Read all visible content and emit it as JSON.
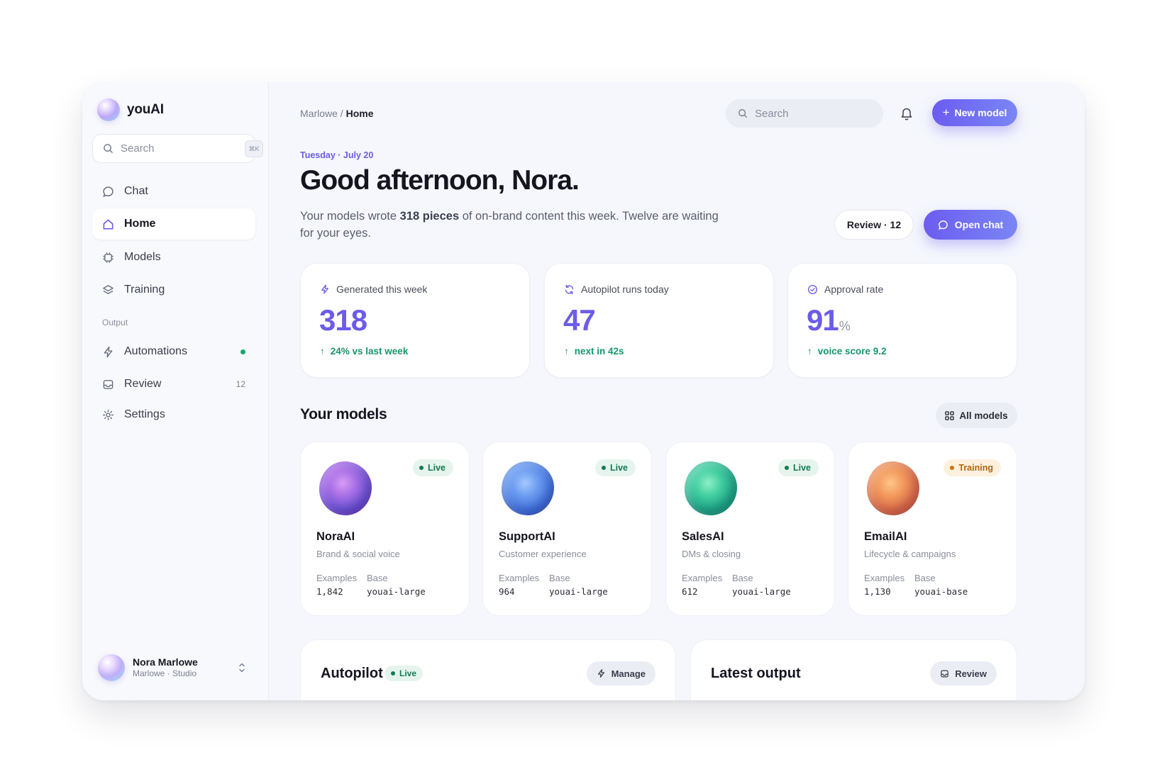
{
  "app": {
    "name": "youAI"
  },
  "sidebar": {
    "search_placeholder": "Search",
    "shortcut": "⌘K",
    "items": [
      {
        "label": "Chat",
        "icon": "chat-bubble-icon"
      },
      {
        "label": "Home",
        "icon": "home-icon",
        "active": true
      },
      {
        "label": "Models",
        "icon": "chip-icon"
      },
      {
        "label": "Training",
        "icon": "layers-icon"
      }
    ],
    "section_label": "Output",
    "output_items": [
      {
        "label": "Automations",
        "icon": "bolt-icon",
        "status": "active"
      },
      {
        "label": "Review",
        "icon": "inbox-icon",
        "count": "12"
      },
      {
        "label": "Settings",
        "icon": "gear-icon"
      }
    ],
    "user": {
      "name": "Nora Marlowe",
      "subtitle": "Marlowe · Studio"
    }
  },
  "header": {
    "breadcrumb_parent": "Marlowe",
    "breadcrumb_sep": " / ",
    "breadcrumb_current": "Home",
    "search_placeholder": "Search",
    "new_model_label": "New model"
  },
  "hero": {
    "date": "Tuesday · July 20",
    "greeting": "Good afternoon, Nora.",
    "summary_pre": "Your models wrote ",
    "summary_bold": "318 pieces",
    "summary_post": " of on-brand content this week. Twelve are waiting for your eyes.",
    "review_label": "Review · 12",
    "open_chat_label": "Open chat"
  },
  "stats": [
    {
      "label": "Generated this week",
      "value": "318",
      "unit": "",
      "delta": "24% vs last week",
      "icon": "bolt-icon"
    },
    {
      "label": "Autopilot runs today",
      "value": "47",
      "unit": "",
      "delta": "next in 42s",
      "icon": "refresh-icon"
    },
    {
      "label": "Approval rate",
      "value": "91",
      "unit": "%",
      "delta": "voice score 9.2",
      "icon": "check-circle-icon"
    }
  ],
  "models_section": {
    "title": "Your models",
    "all_label": "All models",
    "examples_label": "Examples",
    "base_label": "Base",
    "models": [
      {
        "name": "NoraAI",
        "desc": "Brand & social voice",
        "status": "Live",
        "examples": "1,842",
        "base": "youai-large"
      },
      {
        "name": "SupportAI",
        "desc": "Customer experience",
        "status": "Live",
        "examples": "964",
        "base": "youai-large"
      },
      {
        "name": "SalesAI",
        "desc": "DMs & closing",
        "status": "Live",
        "examples": "612",
        "base": "youai-large"
      },
      {
        "name": "EmailAI",
        "desc": "Lifecycle & campaigns",
        "status": "Training",
        "examples": "1,130",
        "base": "youai-base"
      }
    ]
  },
  "bottom": {
    "autopilot": {
      "title": "Autopilot",
      "badge": "Live",
      "button": "Manage"
    },
    "latest": {
      "title": "Latest output",
      "button": "Review"
    }
  },
  "colors": {
    "accent": "#6c5ce7",
    "positive": "#17976a",
    "live": "#147a52",
    "training": "#b0650e"
  }
}
